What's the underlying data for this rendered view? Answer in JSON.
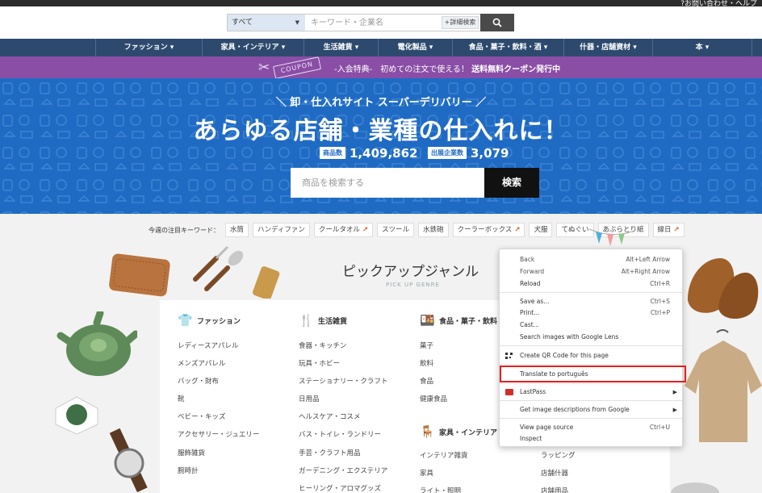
{
  "topbar": {
    "help_text": "?お問い合わせ・ヘルプ"
  },
  "search": {
    "category": "すべて",
    "placeholder": "キーワード・企業名",
    "detail_label": "+詳細検索"
  },
  "nav": {
    "items": [
      "ファッション ▾",
      "家具・インテリア ▾",
      "生活雑貨 ▾",
      "電化製品 ▾",
      "食品・菓子・飲料・酒 ▾",
      "什器・店舗資材 ▾",
      "本 ▾"
    ]
  },
  "coupon_banner": {
    "badge": "COUPON",
    "lead": "-入会特典-　初めての注文で使える！",
    "highlight": "送料無料クーポン発行中"
  },
  "hero": {
    "subtitle": "＼ 卸・仕入れサイト スーパーデリバリー ／",
    "title": "あらゆる店舗・業種の仕入れに！",
    "stats": [
      {
        "tag": "商品数",
        "value": "1,409,862"
      },
      {
        "tag": "出展企業数",
        "value": "3,079"
      }
    ],
    "search_placeholder": "商品を検索する",
    "search_button": "検索"
  },
  "keywords": {
    "label": "今週の注目キーワード：",
    "items": [
      {
        "text": "水筒",
        "hot": false
      },
      {
        "text": "ハンディファン",
        "hot": false
      },
      {
        "text": "クールタオル",
        "hot": true
      },
      {
        "text": "スツール",
        "hot": false
      },
      {
        "text": "水鉄砲",
        "hot": false
      },
      {
        "text": "クーラーボックス",
        "hot": true
      },
      {
        "text": "犬服",
        "hot": false
      },
      {
        "text": "てぬぐい",
        "hot": false
      },
      {
        "text": "あぶらとり紙",
        "hot": false
      },
      {
        "text": "縁日",
        "hot": true
      }
    ]
  },
  "pickup": {
    "title": "ピックアップジャンル",
    "subtitle": "PICK UP GENRE"
  },
  "genres": {
    "fashion": {
      "title": "ファッション",
      "items": [
        "レディースアパレル",
        "メンズアパレル",
        "バッグ・財布",
        "靴",
        "ベビー・キッズ",
        "アクセサリー・ジュエリー",
        "服飾雑貨",
        "腕時計"
      ]
    },
    "daily": {
      "title": "生活雑貨",
      "items": [
        "食器・キッチン",
        "玩具・ホビー",
        "ステーショナリー・クラフト",
        "日用品",
        "ヘルスケア・コスメ",
        "バス・トイレ・ランドリー",
        "手芸・クラフト用品",
        "ガーデニング・エクステリア",
        "ヒーリング・アロマグッズ"
      ]
    },
    "food": {
      "title": "食品・菓子・飲料",
      "items": [
        "菓子",
        "飲料",
        "食品",
        "健康食品"
      ]
    },
    "furniture": {
      "title": "家具・インテリア",
      "items": [
        "インテリア雑貨",
        "家具",
        "ライト・照明"
      ]
    },
    "partial": {
      "items": [
        "ラッピング",
        "店舗什器",
        "店舗用品"
      ]
    }
  },
  "context_menu": {
    "back": "Back",
    "back_sc": "Alt+Left Arrow",
    "forward": "Forward",
    "forward_sc": "Alt+Right Arrow",
    "reload": "Reload",
    "reload_sc": "Ctrl+R",
    "save_as": "Save as...",
    "save_as_sc": "Ctrl+S",
    "print": "Print...",
    "print_sc": "Ctrl+P",
    "cast": "Cast...",
    "search_images": "Search images with Google Lens",
    "qr": "Create QR Code for this page",
    "translate": "Translate to português",
    "lastpass": "LastPass",
    "image_desc": "Get image descriptions from Google",
    "view_source": "View page source",
    "view_source_sc": "Ctrl+U",
    "inspect": "Inspect"
  },
  "colors": {
    "nav": "#2d4a6e",
    "banner": "#8a4ea6",
    "hero": "#1f6bc4",
    "highlight": "#e0201f"
  }
}
